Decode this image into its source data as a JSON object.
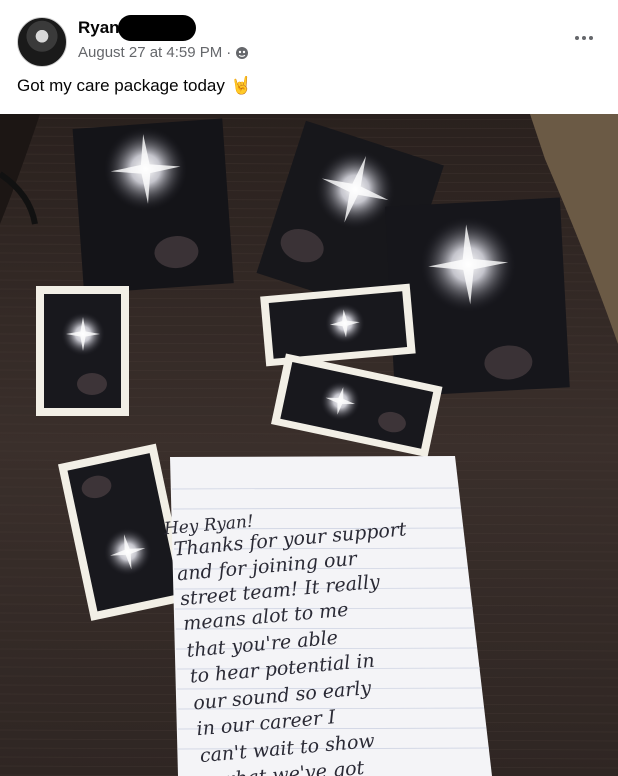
{
  "post": {
    "author_name": "Ryan",
    "timestamp": "August 27 at 4:59 PM",
    "separator": "·",
    "audience_icon": "globe-icon",
    "more_icon": "more-options-icon",
    "caption": "Got my care package today",
    "caption_emoji": "🤘"
  },
  "photo": {
    "handwritten_note": {
      "lines": [
        "Hey Ryan!",
        "Thanks for your support",
        "and for joining our",
        "street team! It really",
        "means alot to me",
        "that you're able",
        "to hear potential in",
        "our sound so early",
        "in our career I",
        "can't wait to show",
        "what we've got"
      ]
    }
  }
}
